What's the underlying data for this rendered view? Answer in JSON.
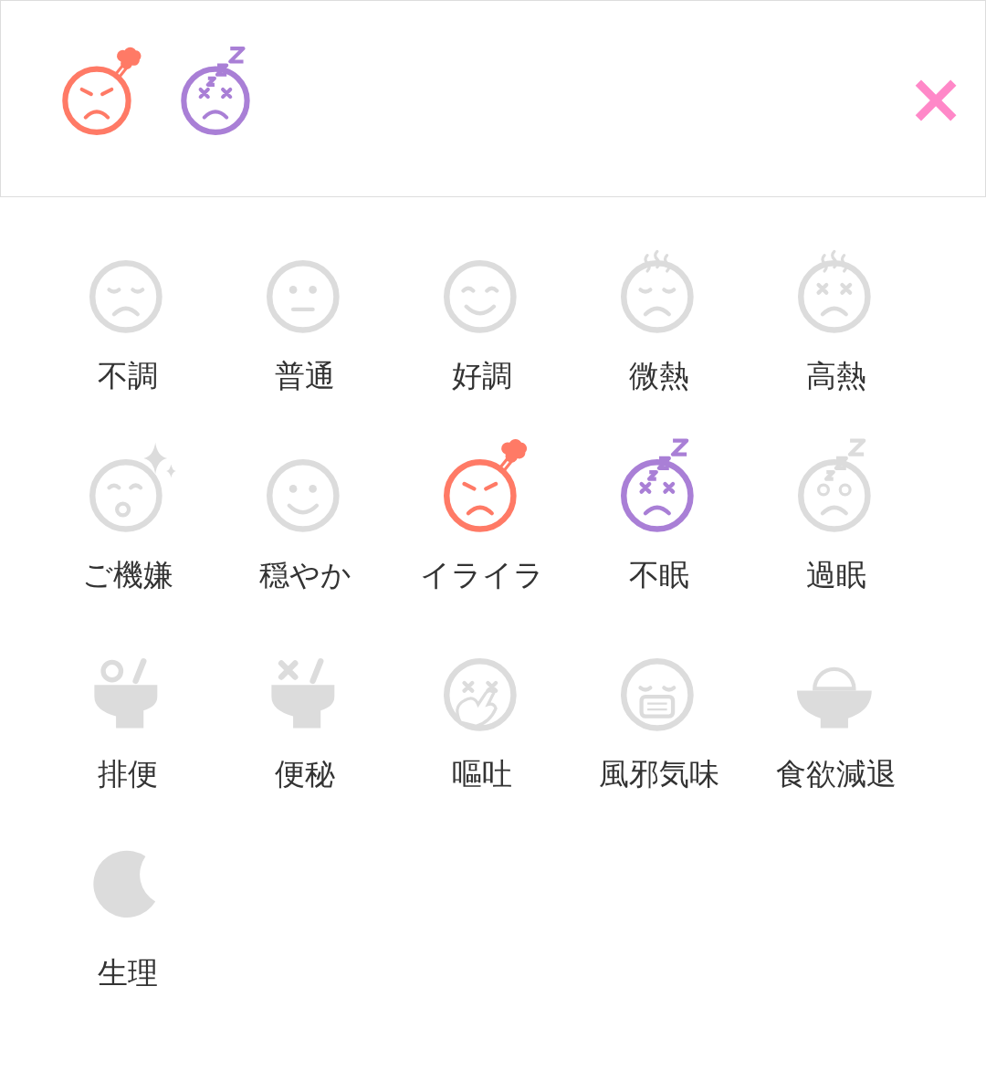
{
  "header": {
    "close": "×"
  },
  "items": [
    {
      "kind": "unwell",
      "label": "不調",
      "selected": false
    },
    {
      "kind": "normal",
      "label": "普通",
      "selected": false
    },
    {
      "kind": "good",
      "label": "好調",
      "selected": false
    },
    {
      "kind": "slight-fever",
      "label": "微熱",
      "selected": false
    },
    {
      "kind": "high-fever",
      "label": "高熱",
      "selected": false
    },
    {
      "kind": "happy",
      "label": "ご機嫌",
      "selected": false
    },
    {
      "kind": "calm",
      "label": "穏やか",
      "selected": false
    },
    {
      "kind": "irritated",
      "label": "イライラ",
      "selected": true
    },
    {
      "kind": "insomnia",
      "label": "不眠",
      "selected": true
    },
    {
      "kind": "oversleep",
      "label": "過眠",
      "selected": false
    },
    {
      "kind": "bowel",
      "label": "排便",
      "selected": false
    },
    {
      "kind": "constipation",
      "label": "便秘",
      "selected": false
    },
    {
      "kind": "vomit",
      "label": "嘔吐",
      "selected": false
    },
    {
      "kind": "cold",
      "label": "風邪気味",
      "selected": false
    },
    {
      "kind": "appetite-loss",
      "label": "食欲減退",
      "selected": false
    },
    {
      "kind": "period",
      "label": "生理",
      "selected": false
    }
  ]
}
